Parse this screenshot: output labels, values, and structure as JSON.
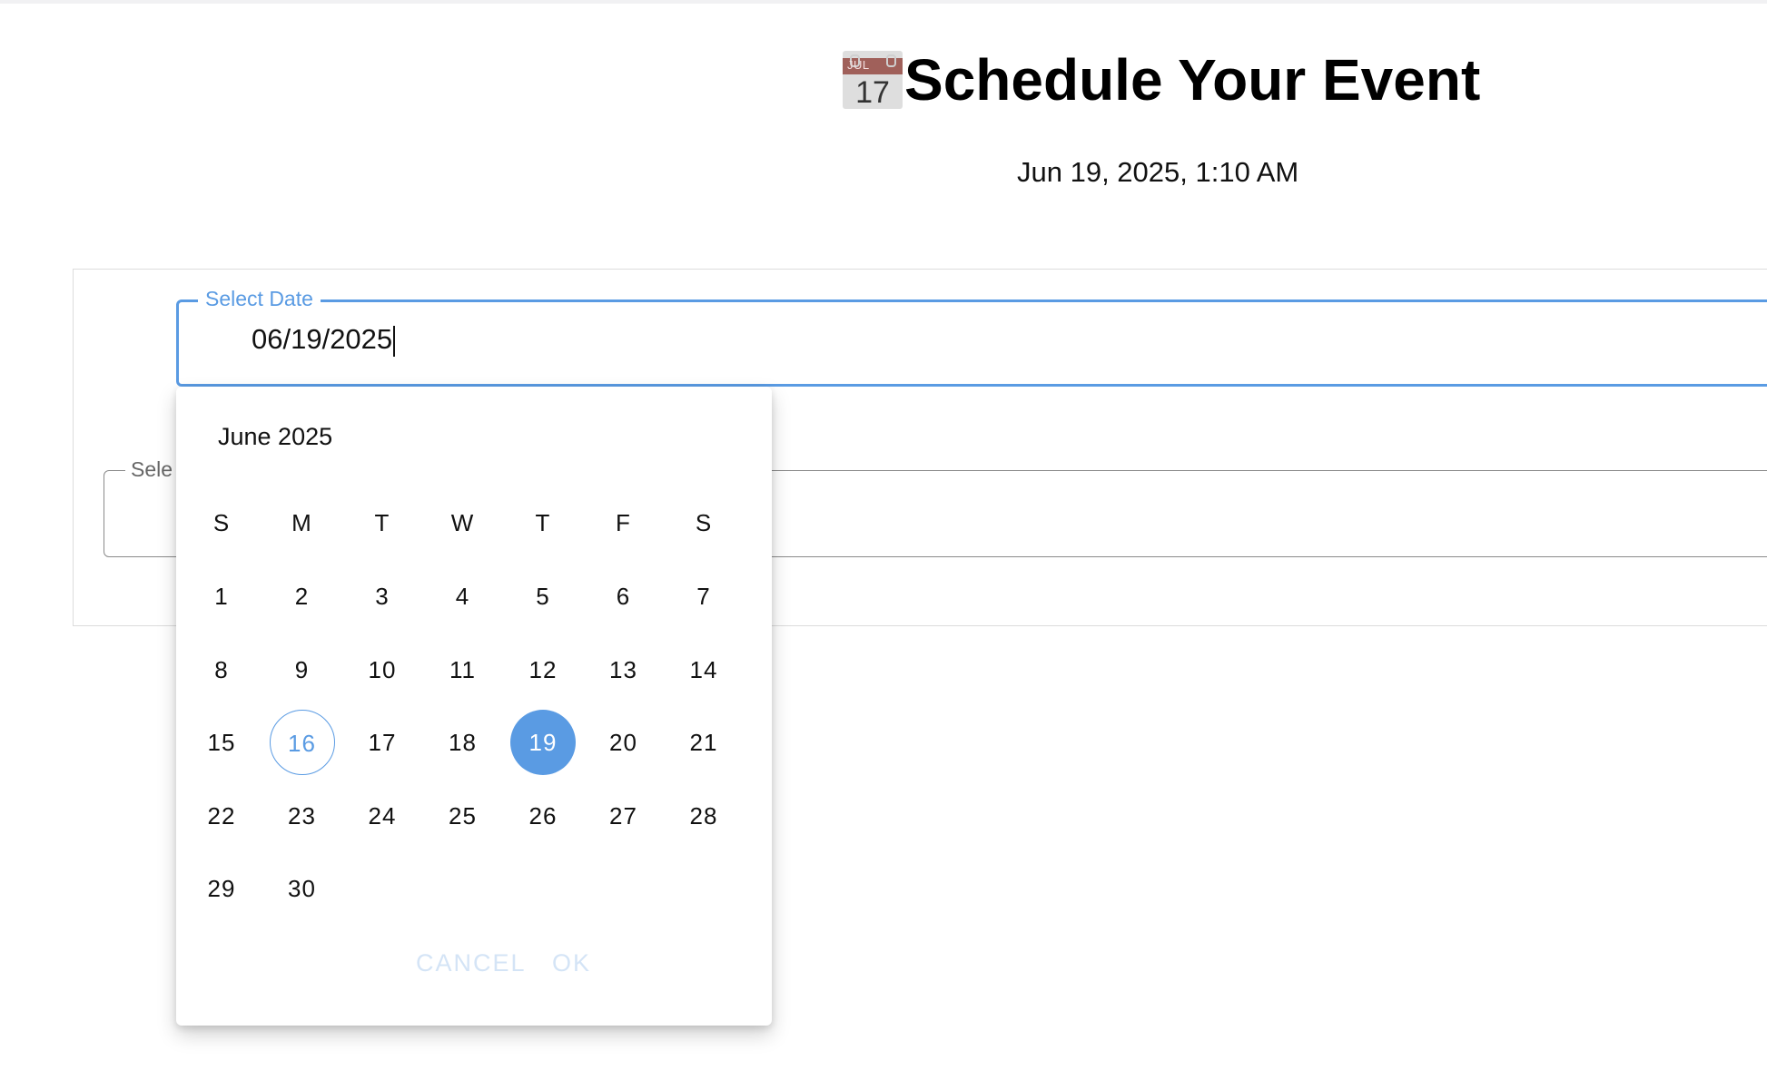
{
  "header": {
    "icon_month": "JUL",
    "icon_day": "17",
    "title": "Schedule Your Event",
    "current_datetime": "Jun 19, 2025, 1:10 AM"
  },
  "form": {
    "date_field": {
      "label": "Select Date",
      "value": "06/19/2025",
      "focused": true
    },
    "second_field": {
      "label_visible": "Sele"
    }
  },
  "date_picker": {
    "month_label": "June 2025",
    "weekdays": [
      "S",
      "M",
      "T",
      "W",
      "T",
      "F",
      "S"
    ],
    "weeks": [
      [
        "1",
        "2",
        "3",
        "4",
        "5",
        "6",
        "7"
      ],
      [
        "8",
        "9",
        "10",
        "11",
        "12",
        "13",
        "14"
      ],
      [
        "15",
        "16",
        "17",
        "18",
        "19",
        "20",
        "21"
      ],
      [
        "22",
        "23",
        "24",
        "25",
        "26",
        "27",
        "28"
      ],
      [
        "29",
        "30"
      ]
    ],
    "today": "16",
    "selected": "19",
    "cancel_label": "CANCEL",
    "ok_label": "OK"
  },
  "colors": {
    "accent": "#5a9be3",
    "disabled_button": "#d4e4f6"
  }
}
